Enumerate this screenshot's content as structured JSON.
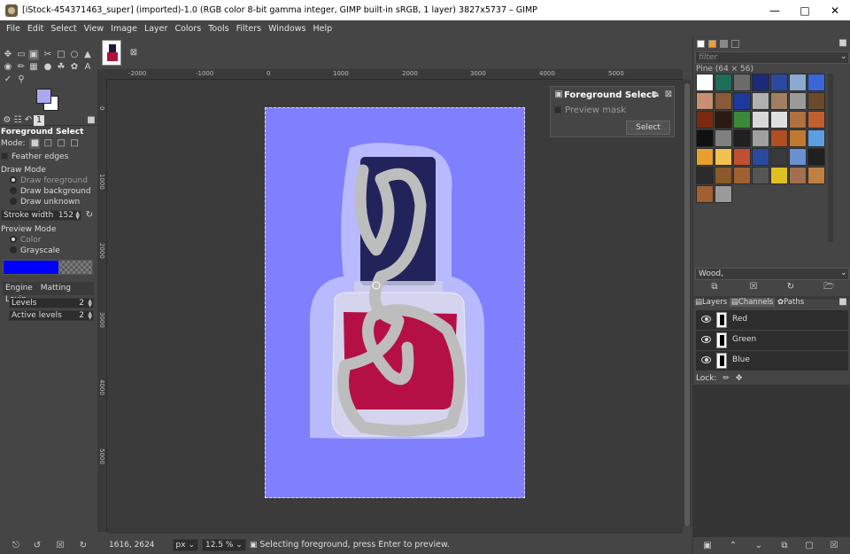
{
  "window": {
    "title": "[iStock-454371463_super] (imported)-1.0 (RGB color 8-bit gamma integer, GIMP built-in sRGB, 1 layer) 3827x5737 – GIMP"
  },
  "menu": [
    "File",
    "Edit",
    "Select",
    "View",
    "Image",
    "Layer",
    "Colors",
    "Tools",
    "Filters",
    "Windows",
    "Help"
  ],
  "colors": {
    "foreground": "#a9a9f0",
    "background": "#ffffff",
    "mask": "#8080fe",
    "highlight": "#0000ff"
  },
  "tool_options": {
    "title": "Foreground Select",
    "mode_label": "Mode:",
    "feather_edges": "Feather edges",
    "draw_mode_label": "Draw Mode",
    "draw_modes": [
      "Draw foreground",
      "Draw background",
      "Draw unknown"
    ],
    "selected_draw_mode": "Draw foreground",
    "stroke_width_label": "Stroke width",
    "stroke_width": "152",
    "preview_mode_label": "Preview Mode",
    "preview_modes": [
      "Color",
      "Grayscale"
    ],
    "selected_preview_mode": "Color",
    "engine_label": "Engine",
    "engine": "Matting Levin",
    "levels_label": "Levels",
    "levels": "2",
    "active_levels_label": "Active levels",
    "active_levels": "2"
  },
  "ruler": {
    "h_ticks": [
      "-2000",
      "-1000",
      "0",
      "1000",
      "2000",
      "3000",
      "4000",
      "5000"
    ],
    "v_ticks": [
      "0",
      "1000",
      "2000",
      "3000",
      "4000",
      "5000"
    ]
  },
  "fg_dialog": {
    "title": "Foreground Select",
    "preview_mask": "Preview mask",
    "select_button": "Select"
  },
  "statusbar": {
    "coords": "1616, 2624",
    "unit": "px",
    "zoom": "12.5 %",
    "message": "Selecting foreground, press Enter to preview."
  },
  "patterns": {
    "filter_placeholder": "filter",
    "selected_name": "Pine (64 × 56)",
    "tag_value": "Wood,"
  },
  "layers_tabs": [
    "Layers",
    "Channels",
    "Paths"
  ],
  "channels": [
    {
      "name": "Red"
    },
    {
      "name": "Green"
    },
    {
      "name": "Blue"
    }
  ],
  "lock_label": "Lock:"
}
